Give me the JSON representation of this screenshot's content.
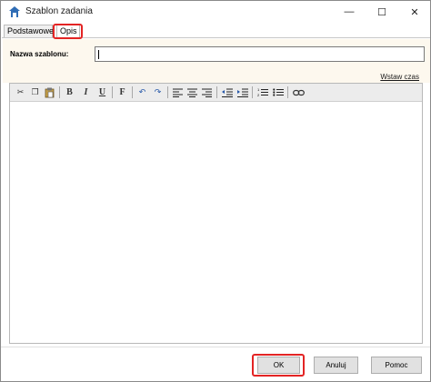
{
  "window": {
    "title": "Szablon zadania",
    "minimize_glyph": "—",
    "maximize_glyph": "☐",
    "close_glyph": "✕"
  },
  "tabs": [
    {
      "label": "Podstawowe",
      "selected": false
    },
    {
      "label": "Opis",
      "selected": true
    }
  ],
  "form": {
    "name_label": "Nazwa szablonu:",
    "name_value": "",
    "insert_time_link": "Wstaw czas"
  },
  "toolbar": {
    "buttons": [
      {
        "icon": "cut-icon",
        "glyph": "✂"
      },
      {
        "icon": "copy-icon",
        "glyph": "❐"
      },
      {
        "icon": "paste-icon",
        "glyph": "📋"
      },
      {
        "icon": "bold-icon",
        "glyph": "B"
      },
      {
        "icon": "italic-icon",
        "glyph": "I"
      },
      {
        "icon": "underline-icon",
        "glyph": "U"
      },
      {
        "icon": "font-icon",
        "glyph": "F"
      },
      {
        "icon": "undo-icon",
        "glyph": "↶"
      },
      {
        "icon": "redo-icon",
        "glyph": "↷"
      },
      {
        "icon": "align-left-icon",
        "glyph": "≡"
      },
      {
        "icon": "align-center-icon",
        "glyph": "≡"
      },
      {
        "icon": "align-right-icon",
        "glyph": "≡"
      },
      {
        "icon": "outdent-icon",
        "glyph": "⇤"
      },
      {
        "icon": "indent-icon",
        "glyph": "⇥"
      },
      {
        "icon": "numbered-list-icon",
        "glyph": "⒈"
      },
      {
        "icon": "bullet-list-icon",
        "glyph": "☰"
      },
      {
        "icon": "link-icon",
        "glyph": "⊂⊃"
      }
    ]
  },
  "buttons": {
    "ok": "OK",
    "cancel": "Anuluj",
    "help": "Pomoc"
  },
  "colors": {
    "highlight": "#e32424",
    "form_background": "#fdf8ee",
    "button_face": "#e1e1e1"
  }
}
